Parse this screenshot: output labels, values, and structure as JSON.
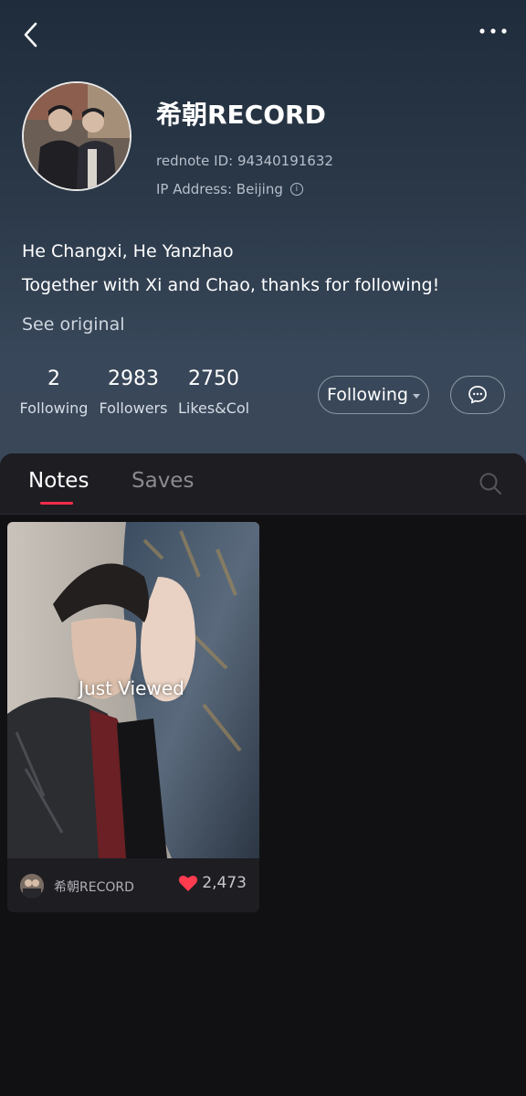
{
  "profile": {
    "name": "希朝RECORD",
    "rednote_id": "rednote ID: 94340191632",
    "ip_address": "IP Address: Beijing",
    "bio_line1": "He Changxi, He Yanzhao",
    "bio_line2": "Together with Xi and Chao, thanks for following!",
    "see_original": "See original"
  },
  "stats": [
    {
      "value": "2",
      "label": "Following"
    },
    {
      "value": "2983",
      "label": "Followers"
    },
    {
      "value": "2750",
      "label": "Likes&Col"
    }
  ],
  "actions": {
    "following_label": "Following"
  },
  "tabs": [
    {
      "label": "Notes",
      "active": true
    },
    {
      "label": "Saves",
      "active": false
    }
  ],
  "notes": [
    {
      "badge": "Just Viewed",
      "author": "希朝RECORD",
      "likes": "2,473"
    }
  ],
  "colors": {
    "accent": "#ff2c4b",
    "like_heart": "#ff3b50",
    "background": "#111114"
  },
  "icons": {
    "back": "back-arrow-icon",
    "more": "more-dots-icon",
    "info": "info-icon",
    "chat": "chat-bubble-icon",
    "search": "search-icon",
    "heart": "heart-icon"
  }
}
